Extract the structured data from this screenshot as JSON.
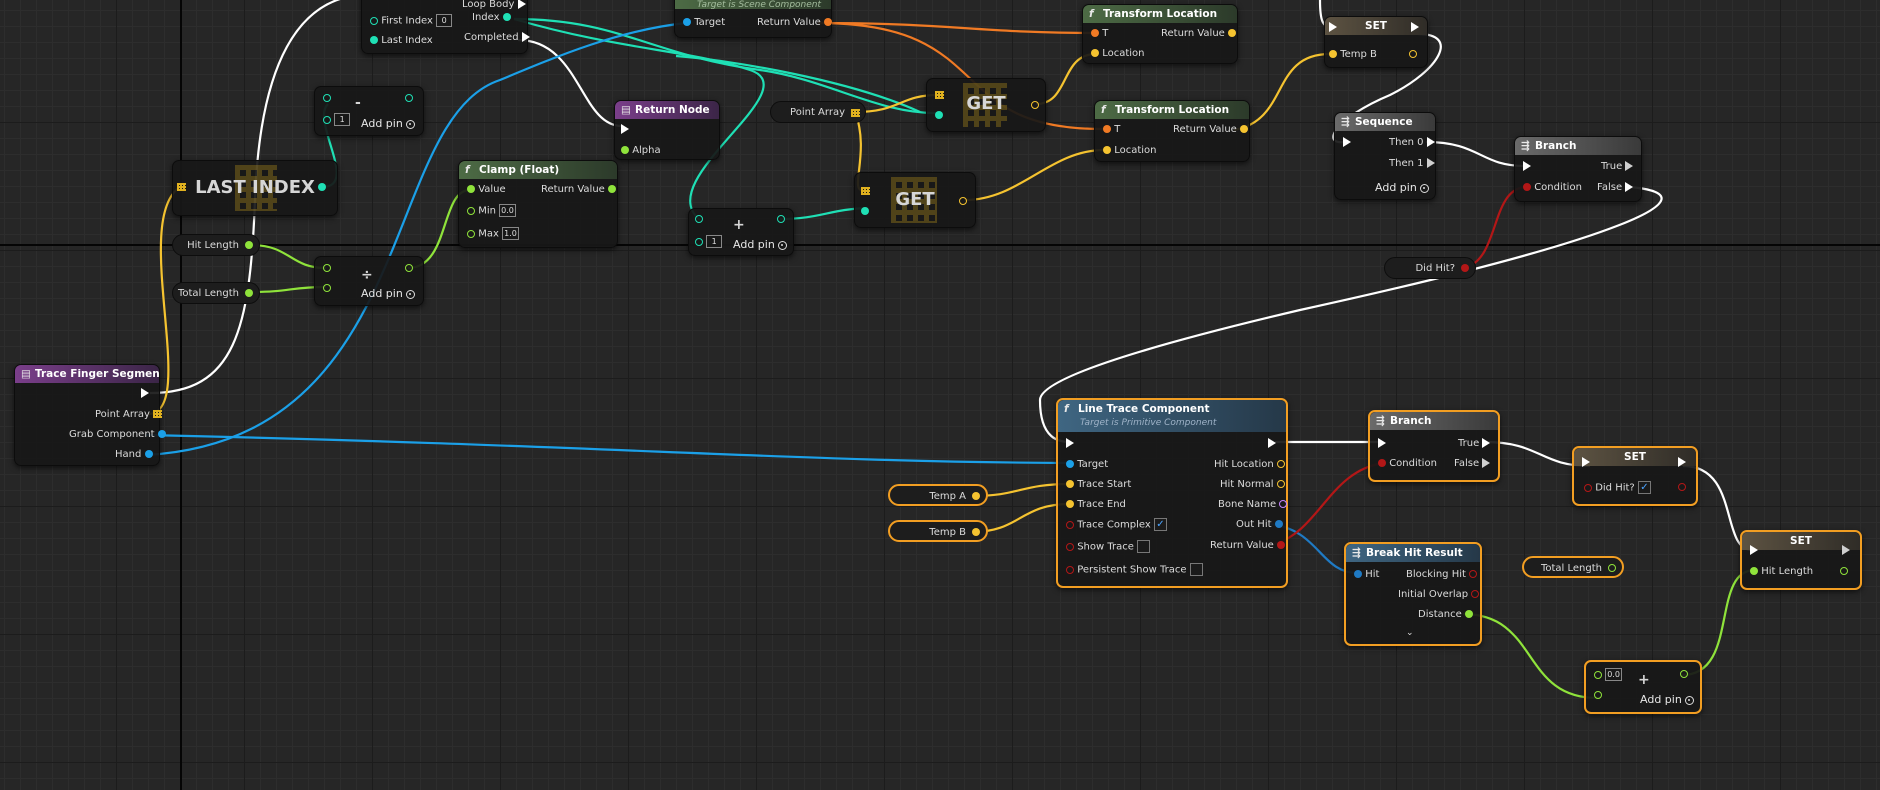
{
  "nodes": {
    "for_loop": {
      "loop_body": "Loop Body",
      "first_index": "First Index",
      "first_index_value": "0",
      "last_index": "Last Index",
      "index": "Index",
      "completed": "Completed"
    },
    "target_node": {
      "subtitle": "Target is Scene Component",
      "target": "Target",
      "return_value": "Return Value"
    },
    "transform_location_1": {
      "title": "Transform Location",
      "t": "T",
      "location": "Location",
      "return_value": "Return Value"
    },
    "transform_location_2": {
      "title": "Transform Location",
      "t": "T",
      "location": "Location",
      "return_value": "Return Value"
    },
    "set_temp_b": {
      "title": "SET",
      "pin": "Temp B"
    },
    "subtract": {
      "op": "-",
      "value": "1",
      "add_pin": "Add pin"
    },
    "last_index": {
      "title": "LAST INDEX"
    },
    "return_node": {
      "title": "Return Node",
      "alpha": "Alpha"
    },
    "clamp": {
      "title": "Clamp (Float)",
      "value": "Value",
      "return_value": "Return Value",
      "min": "Min",
      "min_value": "0.0",
      "max": "Max",
      "max_value": "1.0"
    },
    "point_array_var": {
      "label": "Point Array"
    },
    "get_1": {
      "title": "GET"
    },
    "get_2": {
      "title": "GET"
    },
    "add_1": {
      "op": "+",
      "value": "1",
      "add_pin": "Add pin"
    },
    "sequence": {
      "title": "Sequence",
      "then0": "Then 0",
      "then1": "Then 1",
      "add_pin": "Add pin"
    },
    "branch_1": {
      "title": "Branch",
      "true": "True",
      "condition": "Condition",
      "false": "False"
    },
    "hit_length_var": {
      "label": "Hit Length"
    },
    "total_length_var": {
      "label": "Total Length"
    },
    "divide": {
      "op": "÷",
      "add_pin": "Add pin"
    },
    "did_hit_var": {
      "label": "Did Hit?"
    },
    "trace_finger": {
      "title": "Trace Finger Segment",
      "point_array": "Point Array",
      "grab_component": "Grab Component",
      "hand": "Hand"
    },
    "line_trace": {
      "title": "Line Trace Component",
      "subtitle": "Target is Primitive Component",
      "target": "Target",
      "trace_start": "Trace Start",
      "trace_end": "Trace End",
      "trace_complex": "Trace Complex",
      "show_trace": "Show Trace",
      "persistent": "Persistent Show Trace",
      "hit_location": "Hit Location",
      "hit_normal": "Hit Normal",
      "bone_name": "Bone Name",
      "out_hit": "Out Hit",
      "return_value": "Return Value"
    },
    "temp_a_var": {
      "label": "Temp A"
    },
    "temp_b_var": {
      "label": "Temp B"
    },
    "branch_2": {
      "title": "Branch",
      "true": "True",
      "condition": "Condition",
      "false": "False"
    },
    "set_did_hit": {
      "title": "SET",
      "pin": "Did Hit?"
    },
    "break_hit": {
      "title": "Break Hit Result",
      "hit": "Hit",
      "blocking_hit": "Blocking Hit",
      "initial_overlap": "Initial Overlap",
      "distance": "Distance"
    },
    "total_length_var_2": {
      "label": "Total Length"
    },
    "set_hit_length": {
      "title": "SET",
      "pin": "Hit Length"
    },
    "add_2": {
      "op": "+",
      "value": "0.0",
      "add_pin": "Add pin"
    }
  },
  "colors": {
    "exec": "#ffffff",
    "int": "#1fe0b5",
    "float": "#8fe33b",
    "vector": "#f5c330",
    "object": "#1ba0e8",
    "bool": "#b31717",
    "struct": "#1f7ac4",
    "transform": "#f07a24",
    "name": "#c784ff",
    "selected_outline": "#f29e22"
  }
}
